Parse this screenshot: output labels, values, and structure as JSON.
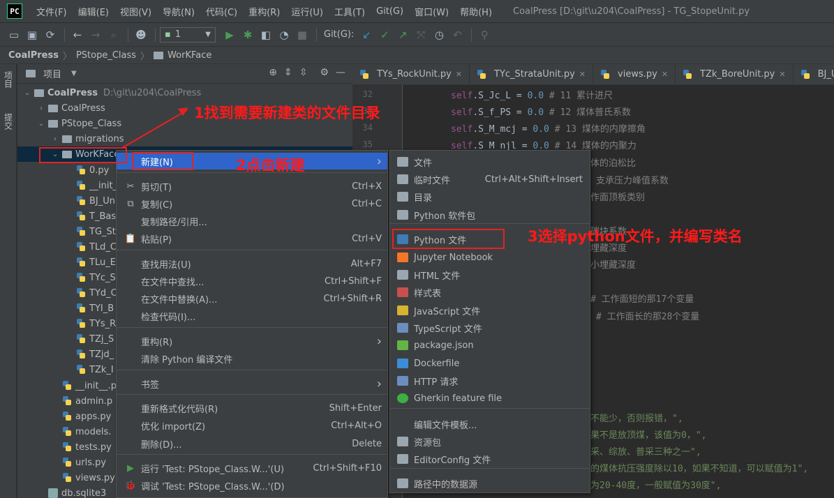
{
  "menubar": {
    "items": [
      "文件(F)",
      "编辑(E)",
      "视图(V)",
      "导航(N)",
      "代码(C)",
      "重构(R)",
      "运行(U)",
      "工具(T)",
      "Git(G)",
      "窗口(W)",
      "帮助(H)"
    ],
    "window_title": "CoalPress [D:\\git\\u204\\CoalPress] - TG_StopeUnit.py"
  },
  "toolbar": {
    "run_config_value": "1",
    "git_label": "Git(G):"
  },
  "breadcrumb": [
    "CoalPress",
    "PStope_Class",
    "WorKFace"
  ],
  "left_stripe": {
    "project": "项目",
    "commit": "提交"
  },
  "project_panel": {
    "title": "项目",
    "root": {
      "name": "CoalPress",
      "path": "D:\\git\\u204\\CoalPress"
    },
    "tree": [
      {
        "label": "CoalPress",
        "indent": 0
      },
      {
        "label": "CoalPress",
        "indent": 1
      },
      {
        "label": "PStope_Class",
        "indent": 1
      },
      {
        "label": "migrations",
        "indent": 2
      },
      {
        "label": "WorKFace",
        "indent": 2
      },
      {
        "label": "0.py",
        "indent": 3
      },
      {
        "label": "__init__",
        "indent": 3
      },
      {
        "label": "BJ_Uni",
        "indent": 3
      },
      {
        "label": "T_Base",
        "indent": 3
      },
      {
        "label": "TG_St",
        "indent": 3
      },
      {
        "label": "TLd_C",
        "indent": 3
      },
      {
        "label": "TLu_E",
        "indent": 3
      },
      {
        "label": "TYc_S",
        "indent": 3
      },
      {
        "label": "TYd_C",
        "indent": 3
      },
      {
        "label": "TYI_B",
        "indent": 3
      },
      {
        "label": "TYs_R",
        "indent": 3
      },
      {
        "label": "TZj_S",
        "indent": 3
      },
      {
        "label": "TZjd_",
        "indent": 3
      },
      {
        "label": "TZk_I",
        "indent": 3
      },
      {
        "label": "__init__.p",
        "indent": 2
      },
      {
        "label": "admin.p",
        "indent": 2
      },
      {
        "label": "apps.py",
        "indent": 2
      },
      {
        "label": "models.",
        "indent": 2
      },
      {
        "label": "tests.py",
        "indent": 2
      },
      {
        "label": "urls.py",
        "indent": 2
      },
      {
        "label": "views.py",
        "indent": 2
      },
      {
        "label": "db.sqlite3",
        "indent": 1
      }
    ]
  },
  "editor": {
    "tabs": [
      "TYs_RockUnit.py",
      "TYc_StrataUnit.py",
      "views.py",
      "TZk_BoreUnit.py",
      "BJ_Unit."
    ],
    "line_numbers": [
      "32",
      "33",
      "34",
      "35"
    ],
    "code": [
      {
        "pre": "self",
        "mid": ".S_Jc_L = ",
        "num": "0.0",
        "cmt": "  # 11 累计进尺"
      },
      {
        "pre": "self",
        "mid": ".S_f_PS = ",
        "num": "0.0",
        "cmt": "  # 12 煤体普氏系数"
      },
      {
        "pre": "self",
        "mid": ".S_M_mcj = ",
        "num": "0.0",
        "cmt": "  # 13 煤体的内摩擦角"
      },
      {
        "pre": "self",
        "mid": ".S_M_njl = ",
        "num": "0.0",
        "cmt": "  # 14 煤体的内聚力"
      }
    ],
    "fragments": [
      "体的泊松比",
      "支承压力峰值系数",
      "作面顶板类别",
      "碳块系数",
      "埋藏深度",
      "小埋藏深度",
      "# 工作面短的那17个变量",
      "# 工作面长的那28个变量",
      "不能少，否则报错，\",",
      "果不是放顶煤，该值为0，\",",
      "采、综放、普采三种之一\",",
      "的煤体抗压强度除以10，如果不知道，可以赋值为1\",",
      "为20-40度，一般赋值为30度\","
    ]
  },
  "context_menu": {
    "items": [
      {
        "label": "新建(N)",
        "shortcut": "",
        "submenu": true,
        "icon": ""
      },
      {
        "label": "剪切(T)",
        "shortcut": "Ctrl+X",
        "icon": "✂"
      },
      {
        "label": "复制(C)",
        "shortcut": "Ctrl+C",
        "icon": "⧉"
      },
      {
        "label": "复制路径/引用...",
        "shortcut": "",
        "icon": ""
      },
      {
        "label": "粘贴(P)",
        "shortcut": "Ctrl+V",
        "icon": "📋"
      },
      {
        "label": "查找用法(U)",
        "shortcut": "Alt+F7",
        "icon": ""
      },
      {
        "label": "在文件中查找...",
        "shortcut": "Ctrl+Shift+F",
        "icon": ""
      },
      {
        "label": "在文件中替换(A)...",
        "shortcut": "Ctrl+Shift+R",
        "icon": ""
      },
      {
        "label": "检查代码(I)...",
        "shortcut": "",
        "icon": ""
      },
      {
        "label": "重构(R)",
        "shortcut": "",
        "submenu": true,
        "icon": ""
      },
      {
        "label": "清除 Python 编译文件",
        "shortcut": "",
        "icon": ""
      },
      {
        "label": "书签",
        "shortcut": "",
        "submenu": true,
        "icon": ""
      },
      {
        "label": "重新格式化代码(R)",
        "shortcut": "Shift+Enter",
        "icon": ""
      },
      {
        "label": "优化 import(Z)",
        "shortcut": "Ctrl+Alt+O",
        "icon": ""
      },
      {
        "label": "删除(D)...",
        "shortcut": "Delete",
        "icon": ""
      },
      {
        "label": "运行 'Test: PStope_Class.W...'(U)",
        "shortcut": "Ctrl+Shift+F10",
        "icon": "▶"
      },
      {
        "label": "调试 'Test: PStope_Class.W...'(D)",
        "shortcut": "",
        "icon": "🐞"
      }
    ]
  },
  "submenu": {
    "items": [
      {
        "label": "文件",
        "shortcut": "",
        "color": "#9aa7b0"
      },
      {
        "label": "临时文件",
        "shortcut": "Ctrl+Alt+Shift+Insert",
        "color": "#9aa7b0"
      },
      {
        "label": "目录",
        "shortcut": "",
        "color": "#9aa7b0"
      },
      {
        "label": "Python 软件包",
        "shortcut": "",
        "color": "#9aa7b0"
      },
      {
        "label": "Python 文件",
        "shortcut": "",
        "color": "#3f7cb3"
      },
      {
        "label": "Jupyter Notebook",
        "shortcut": "",
        "color": "#f37726"
      },
      {
        "label": "HTML 文件",
        "shortcut": "",
        "color": "#9aa7b0"
      },
      {
        "label": "样式表",
        "shortcut": "",
        "color": "#c94f4f"
      },
      {
        "label": "JavaScript 文件",
        "shortcut": "",
        "color": "#d6b330"
      },
      {
        "label": "TypeScript 文件",
        "shortcut": "",
        "color": "#6c8ebf"
      },
      {
        "label": "package.json",
        "shortcut": "",
        "color": "#62b543"
      },
      {
        "label": "Dockerfile",
        "shortcut": "",
        "color": "#3c8dd8"
      },
      {
        "label": "HTTP 请求",
        "shortcut": "",
        "color": "#6c8ebf"
      },
      {
        "label": "Gherkin feature file",
        "shortcut": "",
        "color": "#3cb043"
      },
      {
        "label": "编辑文件模板...",
        "shortcut": "",
        "color": ""
      },
      {
        "label": "资源包",
        "shortcut": "",
        "color": "#9aa7b0"
      },
      {
        "label": "EditorConfig 文件",
        "shortcut": "",
        "color": "#9aa7b0"
      },
      {
        "label": "路径中的数据源",
        "shortcut": "",
        "color": "#9aa7b0"
      }
    ]
  },
  "annotations": {
    "step1": "1找到需要新建类的文件目录",
    "step2": "2点击新建",
    "step3": "3选择python文件，并编写类名"
  },
  "colors": {
    "menu_highlight": "#2f65ca",
    "annotation_red": "#ff1a1a"
  }
}
